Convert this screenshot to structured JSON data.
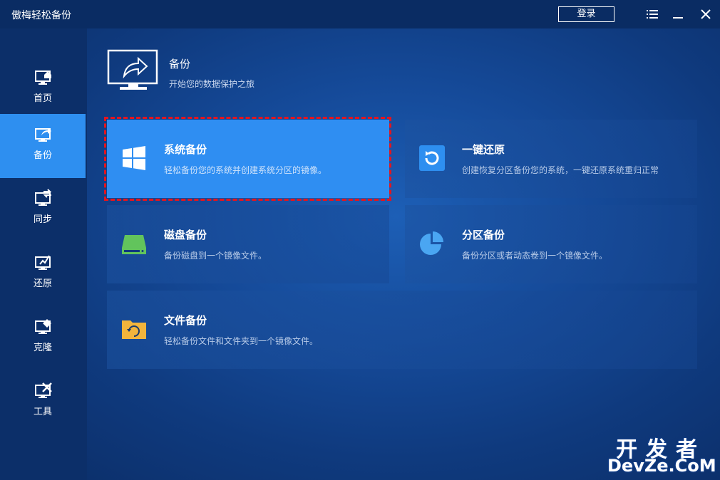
{
  "app": {
    "title": "傲梅轻松备份",
    "login_label": "登录",
    "icons": [
      "menu-icon",
      "minimize-icon",
      "close-icon"
    ]
  },
  "sidebar": {
    "items": [
      {
        "label": "首页",
        "icon": "home-icon",
        "active": false
      },
      {
        "label": "备份",
        "icon": "backup-icon",
        "active": true
      },
      {
        "label": "同步",
        "icon": "sync-icon",
        "active": false
      },
      {
        "label": "还原",
        "icon": "restore-icon",
        "active": false
      },
      {
        "label": "克隆",
        "icon": "clone-icon",
        "active": false
      },
      {
        "label": "工具",
        "icon": "tools-icon",
        "active": false
      }
    ]
  },
  "header": {
    "title": "备份",
    "subtitle": "开始您的数据保护之旅",
    "icon": "backup-monitor-icon"
  },
  "cards": [
    {
      "title": "系统备份",
      "desc": "轻松备份您的系统并创建系统分区的镜像。",
      "icon": "windows-icon"
    },
    {
      "title": "一键还原",
      "desc": "创建恢复分区备份您的系统，一键还原系统重归正常",
      "icon": "one-key-restore-icon"
    },
    {
      "title": "磁盘备份",
      "desc": "备份磁盘到一个镜像文件。",
      "icon": "disk-icon"
    },
    {
      "title": "分区备份",
      "desc": "备份分区或者动态卷到一个镜像文件。",
      "icon": "pie-chart-icon"
    },
    {
      "title": "文件备份",
      "desc": "轻松备份文件和文件夹到一个镜像文件。",
      "icon": "folder-sync-icon"
    }
  ],
  "watermark": {
    "line1": "开发者",
    "line2": "DevZe.CoM"
  },
  "colors": {
    "accent": "#2e8ff0",
    "highlight_border": "#e4151e",
    "sidebar_bg": "#0c2f69"
  }
}
